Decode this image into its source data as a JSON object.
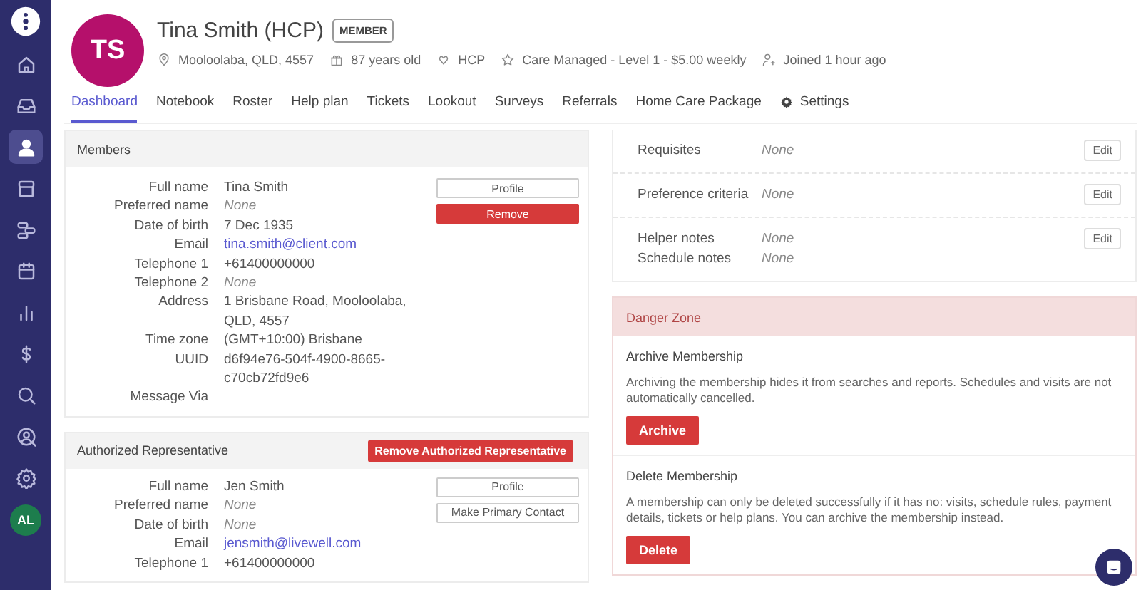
{
  "sidebar": {
    "items": [
      {
        "selected": false
      },
      {
        "selected": false
      },
      {
        "selected": true
      },
      {
        "selected": false
      },
      {
        "selected": false
      },
      {
        "selected": false
      },
      {
        "selected": false
      },
      {
        "selected": false
      },
      {
        "selected": false
      },
      {
        "selected": false
      },
      {
        "selected": false
      }
    ],
    "user_initials": "AL"
  },
  "header": {
    "avatar_initials": "TS",
    "name": "Tina Smith (HCP)",
    "badge": "MEMBER",
    "meta": [
      "Mooloolaba, QLD, 4557",
      "87 years old",
      "HCP",
      "Care Managed - Level 1 - $5.00 weekly",
      "Joined 1 hour ago"
    ]
  },
  "tabs": [
    {
      "label": "Dashboard",
      "selected": true,
      "kind": "text"
    },
    {
      "label": "Notebook",
      "selected": false,
      "kind": "text"
    },
    {
      "label": "Roster",
      "selected": false,
      "kind": "text"
    },
    {
      "label": "Help plan",
      "selected": false,
      "kind": "text"
    },
    {
      "label": "Tickets",
      "selected": false,
      "kind": "text"
    },
    {
      "label": "Lookout",
      "selected": false,
      "kind": "text"
    },
    {
      "label": "Surveys",
      "selected": false,
      "kind": "text"
    },
    {
      "label": "Referrals",
      "selected": false,
      "kind": "text"
    },
    {
      "label": "Home Care Package",
      "selected": false,
      "kind": "text"
    },
    {
      "label": "Settings",
      "selected": false,
      "kind": "settings"
    }
  ],
  "members": {
    "title": "Members",
    "fields": [
      {
        "label": "Full name",
        "value": "Tina Smith",
        "kind": "text"
      },
      {
        "label": "Preferred name",
        "value": "None",
        "kind": "empty"
      },
      {
        "label": "Date of birth",
        "value": "7 Dec 1935",
        "kind": "text"
      },
      {
        "label": "Email",
        "value": "tina.smith@client.com",
        "kind": "link"
      },
      {
        "label": "Telephone 1",
        "value": "+61400000000",
        "kind": "text"
      },
      {
        "label": "Telephone 2",
        "value": "None",
        "kind": "empty"
      },
      {
        "label": "Address",
        "value": "1 Brisbane Road, Mooloolaba, QLD, 4557",
        "kind": "text"
      },
      {
        "label": "Time zone",
        "value": "(GMT+10:00) Brisbane",
        "kind": "text"
      },
      {
        "label": "UUID",
        "value": "d6f94e76-504f-4900-8665-c70cb72fd9e6",
        "kind": "text"
      },
      {
        "label": "Message Via"
      }
    ],
    "buttons": [
      {
        "label": "Profile",
        "kind": "default"
      },
      {
        "label": "Remove",
        "kind": "danger"
      }
    ]
  },
  "authorized_representative": {
    "title": "Authorized Representative",
    "action": "Remove Authorized Representative",
    "fields": [
      {
        "label": "Full name",
        "value": "Jen Smith",
        "kind": "text"
      },
      {
        "label": "Preferred name",
        "value": "None",
        "kind": "empty"
      },
      {
        "label": "Date of birth",
        "value": "None",
        "kind": "empty"
      },
      {
        "label": "Email",
        "value": "jensmith@livewell.com",
        "kind": "link"
      },
      {
        "label": "Telephone 1",
        "value": "+61400000000",
        "kind": "text"
      }
    ],
    "buttons": [
      {
        "label": "Profile"
      },
      {
        "label": "Make Primary Contact"
      }
    ]
  },
  "preferences": [
    {
      "items": [
        {
          "label": "Requisites",
          "value": "None"
        }
      ],
      "action": "Edit"
    },
    {
      "items": [
        {
          "label": "Preference criteria",
          "value": "None"
        }
      ],
      "action": "Edit"
    },
    {
      "items": [
        {
          "label": "Helper notes",
          "value": "None"
        },
        {
          "label": "Schedule notes",
          "value": "None"
        }
      ],
      "action": "Edit"
    }
  ],
  "danger_zone": {
    "title": "Danger Zone",
    "sections": [
      {
        "title": "Archive Membership",
        "text": "Archiving the membership hides it from searches and reports. Schedules and visits are not automatically cancelled.",
        "button": "Archive"
      },
      {
        "title": "Delete Membership",
        "text": "A membership can only be deleted successfully if it has no: visits, schedule rules, payment details, tickets or help plans. You can archive the membership instead.",
        "button": "Delete"
      }
    ]
  }
}
